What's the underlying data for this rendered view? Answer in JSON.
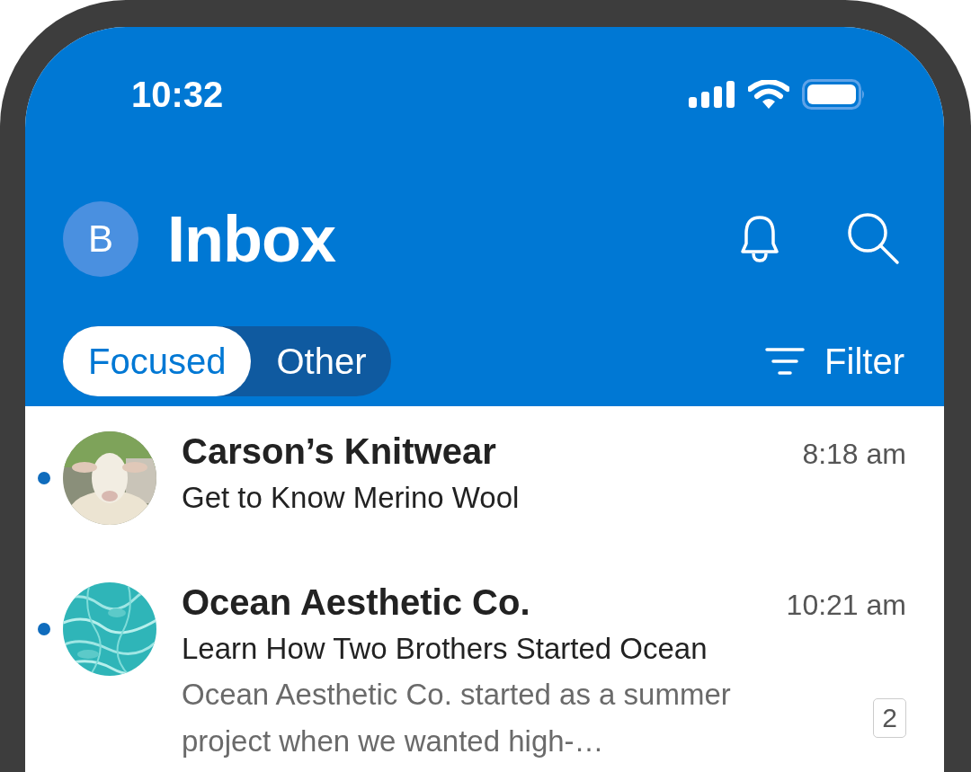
{
  "status_bar": {
    "time": "10:32"
  },
  "header": {
    "avatar_initial": "B",
    "title": "Inbox"
  },
  "tabs": [
    {
      "label": "Focused",
      "selected": true
    },
    {
      "label": "Other",
      "selected": false
    }
  ],
  "filter": {
    "label": "Filter"
  },
  "messages": [
    {
      "sender": "Carson’s Knitwear",
      "time": "8:18 am",
      "subject": "Get to Know Merino Wool",
      "unread": true
    },
    {
      "sender": "Ocean Aesthetic Co.",
      "time": "10:21 am",
      "subject": "Learn How Two Brothers Started Ocean",
      "preview": "Ocean Aesthetic Co. started as a summer project when we wanted high-…",
      "thread_count": "2",
      "unread": true
    }
  ]
}
